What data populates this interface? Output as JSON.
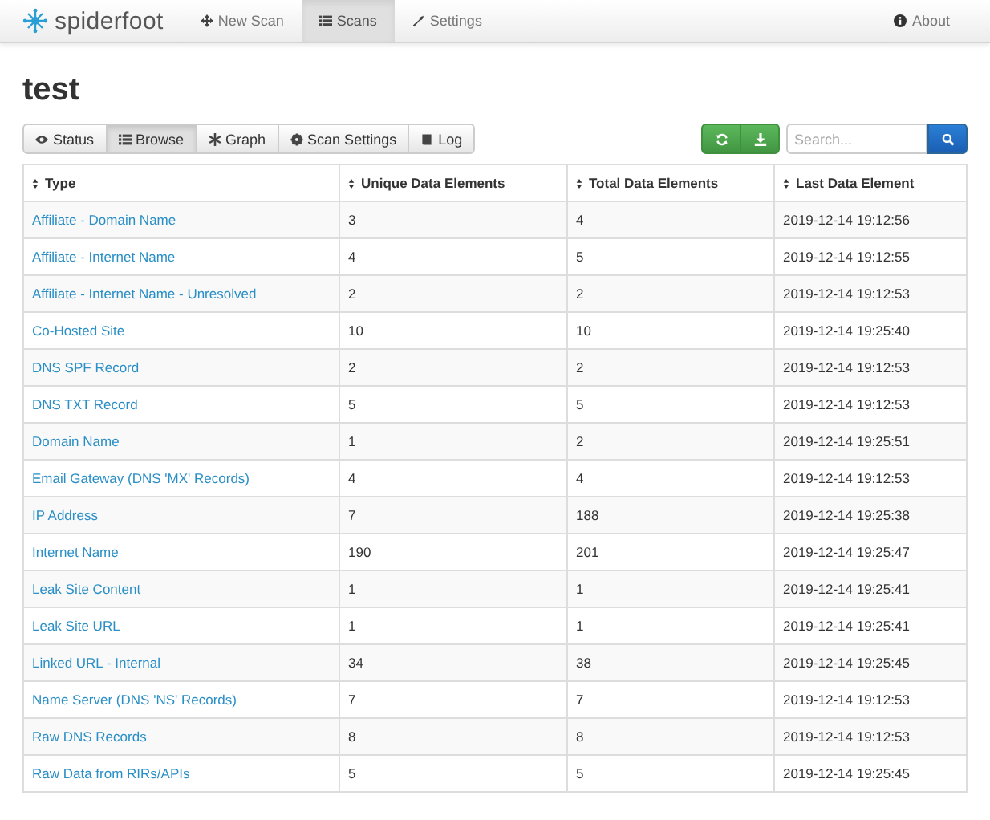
{
  "brand": "spiderfoot",
  "nav": [
    {
      "label": "New Scan",
      "selected": false
    },
    {
      "label": "Scans",
      "selected": true
    },
    {
      "label": "Settings",
      "selected": false
    }
  ],
  "about": "About",
  "title": "test",
  "tabs": [
    {
      "label": "Status",
      "selected": false
    },
    {
      "label": "Browse",
      "selected": true
    },
    {
      "label": "Graph",
      "selected": false
    },
    {
      "label": "Scan Settings",
      "selected": false
    },
    {
      "label": "Log",
      "selected": false
    }
  ],
  "search": {
    "placeholder": "Search..."
  },
  "table": {
    "columns": [
      "Type",
      "Unique Data Elements",
      "Total Data Elements",
      "Last Data Element"
    ],
    "rows": [
      [
        "Affiliate - Domain Name",
        "3",
        "4",
        "2019-12-14 19:12:56"
      ],
      [
        "Affiliate - Internet Name",
        "4",
        "5",
        "2019-12-14 19:12:55"
      ],
      [
        "Affiliate - Internet Name - Unresolved",
        "2",
        "2",
        "2019-12-14 19:12:53"
      ],
      [
        "Co-Hosted Site",
        "10",
        "10",
        "2019-12-14 19:25:40"
      ],
      [
        "DNS SPF Record",
        "2",
        "2",
        "2019-12-14 19:12:53"
      ],
      [
        "DNS TXT Record",
        "5",
        "5",
        "2019-12-14 19:12:53"
      ],
      [
        "Domain Name",
        "1",
        "2",
        "2019-12-14 19:25:51"
      ],
      [
        "Email Gateway (DNS 'MX' Records)",
        "4",
        "4",
        "2019-12-14 19:12:53"
      ],
      [
        "IP Address",
        "7",
        "188",
        "2019-12-14 19:25:38"
      ],
      [
        "Internet Name",
        "190",
        "201",
        "2019-12-14 19:25:47"
      ],
      [
        "Leak Site Content",
        "1",
        "1",
        "2019-12-14 19:25:41"
      ],
      [
        "Leak Site URL",
        "1",
        "1",
        "2019-12-14 19:25:41"
      ],
      [
        "Linked URL - Internal",
        "34",
        "38",
        "2019-12-14 19:25:45"
      ],
      [
        "Name Server (DNS 'NS' Records)",
        "7",
        "7",
        "2019-12-14 19:12:53"
      ],
      [
        "Raw DNS Records",
        "8",
        "8",
        "2019-12-14 19:12:53"
      ],
      [
        "Raw Data from RIRs/APIs",
        "5",
        "5",
        "2019-12-14 19:25:45"
      ]
    ]
  }
}
